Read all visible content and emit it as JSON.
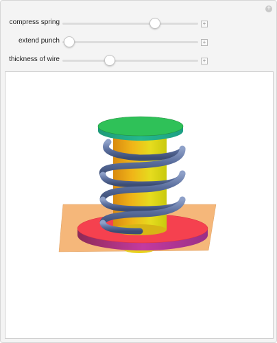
{
  "controls": [
    {
      "label": "compress spring",
      "value": 0.68
    },
    {
      "label": "extend punch",
      "value": 0.05
    },
    {
      "label": "thickness of wire",
      "value": 0.35
    }
  ],
  "icons": {
    "corner": "plus-circle-icon",
    "stepper": "plus-box-icon"
  },
  "colors": {
    "top_plate": "#2fc158",
    "base_disk": "#f5414f",
    "base_disk_side": "#c33aa0",
    "square_plate": "#f5b77a",
    "punch_cylinder": "#e0d21e",
    "spring": "#5b6f9e"
  }
}
